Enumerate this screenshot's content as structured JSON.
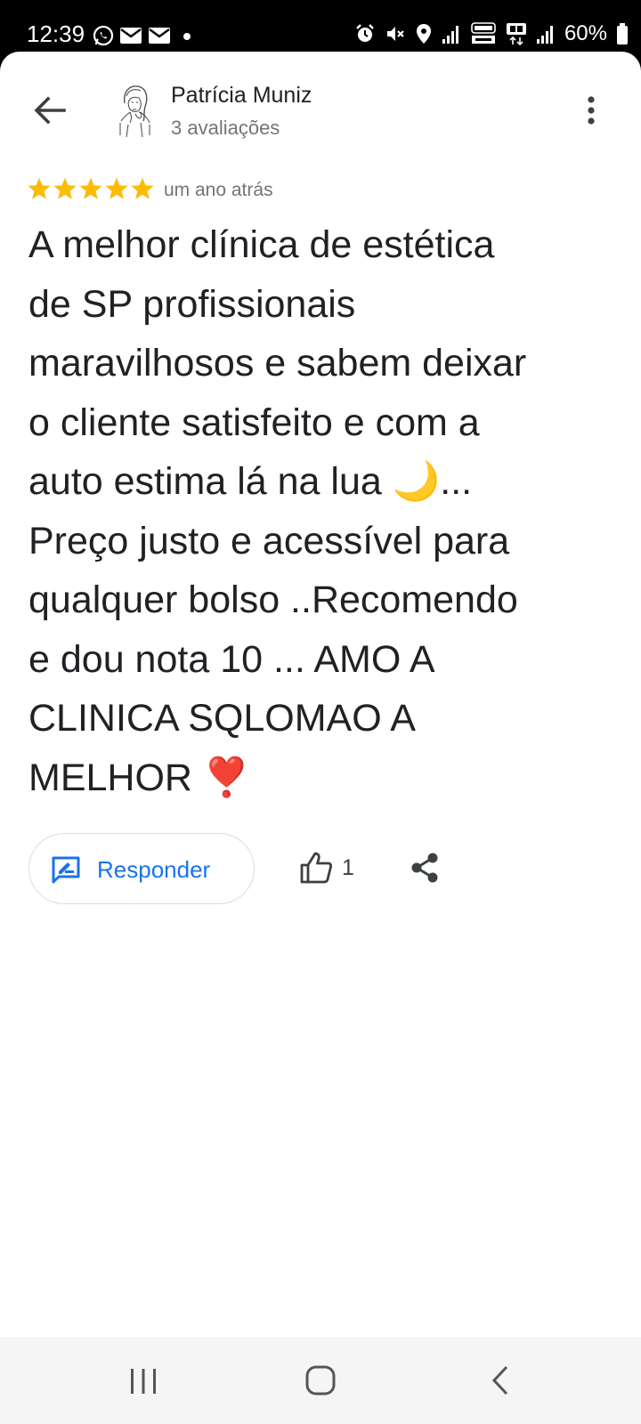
{
  "status_bar": {
    "time": "12:39",
    "battery": "60%",
    "left_icons": [
      "whatsapp-icon",
      "mail-icon",
      "mail-icon",
      "dot-icon"
    ],
    "right_icons": [
      "alarm-icon",
      "mute-icon",
      "location-icon",
      "signal-icon",
      "volte-icon",
      "5g-icon",
      "signal-icon",
      "battery-icon"
    ]
  },
  "header": {
    "reviewer_name": "Patrícia Muniz",
    "review_count": "3 avaliações"
  },
  "review": {
    "rating": 5,
    "date": "um ano atrás",
    "text": "A melhor clínica de estética\nde SP  profissionais\nmaravilhosos e sabem deixar\no cliente satisfeito e com a\nauto estima lá na lua 🌙...\nPreço justo e acessível para\nqualquer bolso ..Recomendo\ne dou nota 10 ... AMO A\nCLINICA SQLOMAO A\nMELHOR ❣️"
  },
  "actions": {
    "reply_label": "Responder",
    "like_count": "1"
  },
  "colors": {
    "star": "#fbbc04",
    "accent": "#1a73e8",
    "text": "#202124",
    "secondary": "#70757a"
  }
}
